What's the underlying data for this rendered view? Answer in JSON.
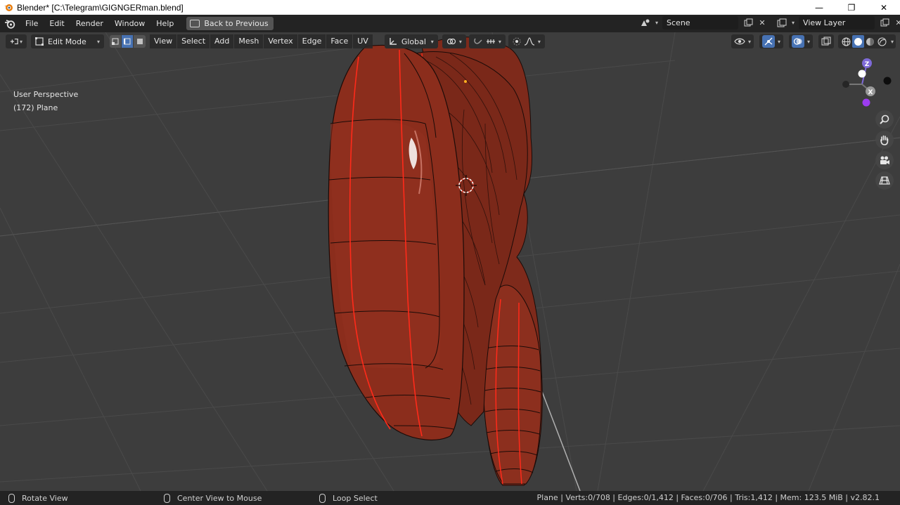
{
  "window": {
    "title": "Blender* [C:\\Telegram\\GIGNGERman.blend]",
    "controls": {
      "minimize": "—",
      "maximize": "❐",
      "close": "✕"
    }
  },
  "topbar": {
    "menus": [
      "File",
      "Edit",
      "Render",
      "Window",
      "Help"
    ],
    "back_button": "Back to Previous",
    "scene": {
      "label": "Scene"
    },
    "view_layer": {
      "label": "View Layer"
    }
  },
  "viewport_header": {
    "mode": "Edit Mode",
    "menus": [
      "View",
      "Select",
      "Add",
      "Mesh",
      "Vertex",
      "Edge",
      "Face",
      "UV"
    ],
    "transform_orientation": "Global",
    "select_mode_active": "edge"
  },
  "viewport": {
    "perspective_label": "User Perspective",
    "object_label": "(172) Plane",
    "gizmo": {
      "z": "Z",
      "x": "X"
    }
  },
  "statusbar": {
    "left_action": "Rotate View",
    "middle_action": "Center View to Mouse",
    "right_action": "Loop Select",
    "stats": "Plane | Verts:0/708 | Edges:0/1,412 | Faces:0/706 | Tris:1,412 | Mem: 123.5 MiB | v2.82.1"
  },
  "colors": {
    "accent": "#4772b3",
    "mesh": "#8a2e1e",
    "seam": "#ff2a1a",
    "header_bg": "#232323",
    "viewport_bg": "#3d3d3d"
  },
  "icons": [
    "blender-logo-icon",
    "back-screen-icon",
    "scene-icon",
    "view-layer-icon",
    "zoom-icon",
    "hand-pan-icon",
    "camera-icon",
    "grid-ortho-icon",
    "mouse-icon"
  ]
}
